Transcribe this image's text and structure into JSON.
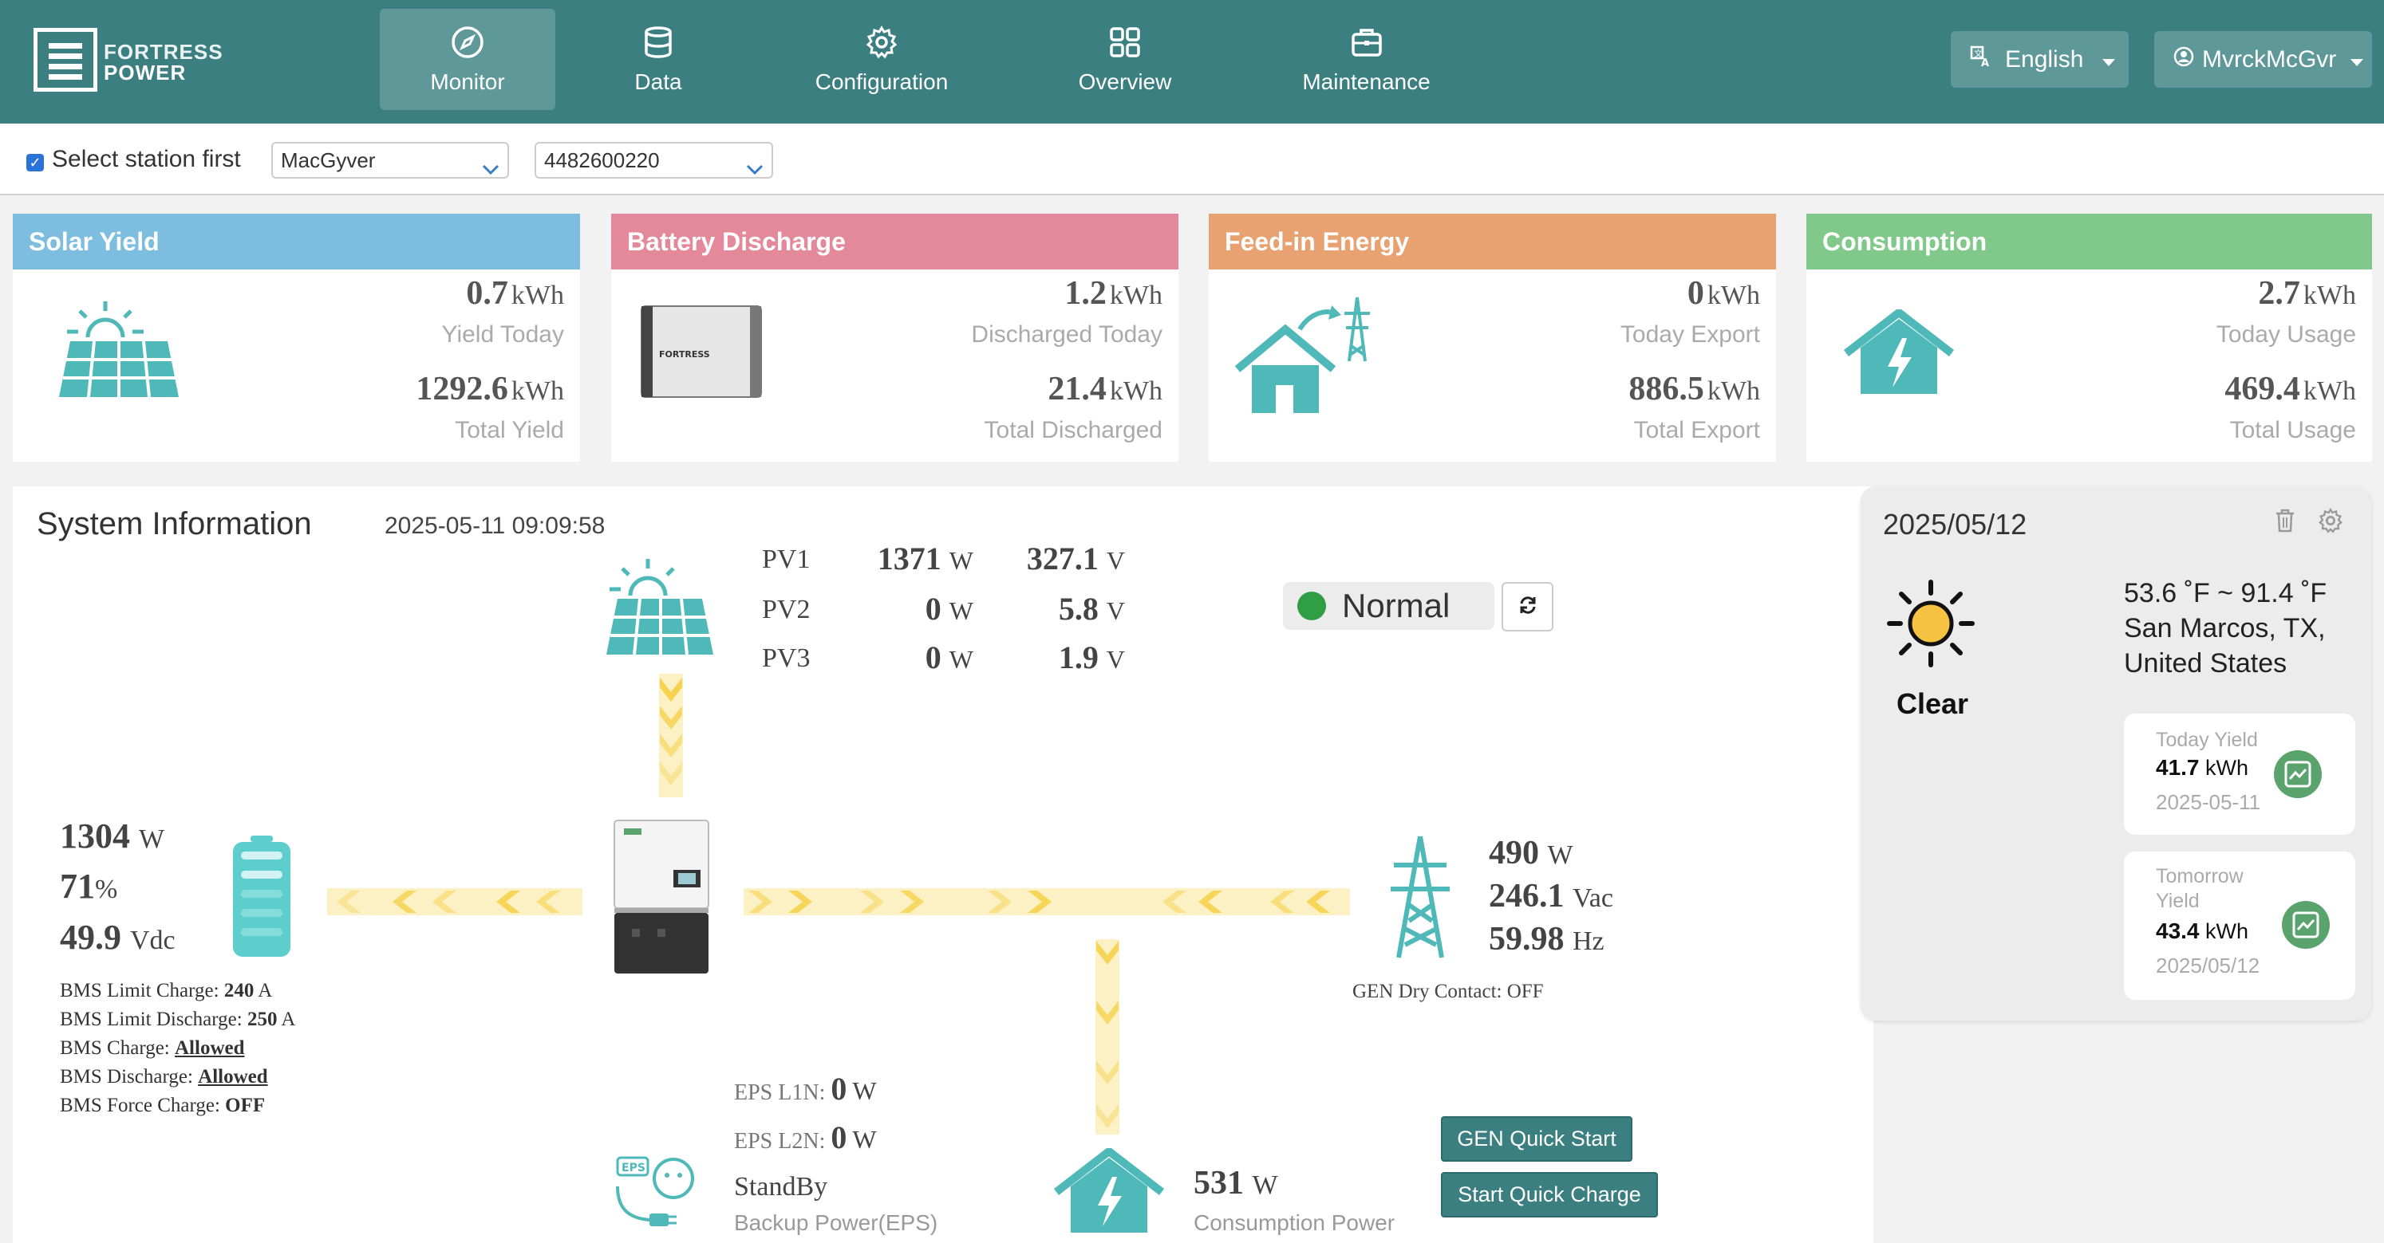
{
  "header": {
    "logo_line1": "FORTRESS",
    "logo_line2": "POWER",
    "nav": [
      {
        "label": "Monitor",
        "icon": "compass-icon",
        "active": true
      },
      {
        "label": "Data",
        "icon": "database-icon"
      },
      {
        "label": "Configuration",
        "icon": "gear-icon"
      },
      {
        "label": "Overview",
        "icon": "grid-icon"
      },
      {
        "label": "Maintenance",
        "icon": "briefcase-icon"
      }
    ],
    "language": "English",
    "user": "MvrckMcGvr"
  },
  "station_bar": {
    "checkbox_label": "Select station first",
    "checked": true,
    "station": "MacGyver",
    "serial": "4482600220"
  },
  "cards": {
    "solar": {
      "title": "Solar Yield",
      "v1": "0.7",
      "u1": "kWh",
      "l1": "Yield Today",
      "v2": "1292.6",
      "u2": "kWh",
      "l2": "Total Yield",
      "color": "#7dbde0"
    },
    "battery": {
      "title": "Battery Discharge",
      "v1": "1.2",
      "u1": "kWh",
      "l1": "Discharged Today",
      "v2": "21.4",
      "u2": "kWh",
      "l2": "Total Discharged",
      "color": "#e4889b",
      "device_text": "FORTRESS"
    },
    "feedin": {
      "title": "Feed-in Energy",
      "v1": "0",
      "u1": "kWh",
      "l1": "Today Export",
      "v2": "886.5",
      "u2": "kWh",
      "l2": "Total Export",
      "color": "#e8a170"
    },
    "consumption": {
      "title": "Consumption",
      "v1": "2.7",
      "u1": "kWh",
      "l1": "Today Usage",
      "v2": "469.4",
      "u2": "kWh",
      "l2": "Total Usage",
      "color": "#80c98a"
    }
  },
  "system": {
    "title": "System Information",
    "timestamp": "2025-05-11 09:09:58",
    "pv": [
      {
        "label": "PV1",
        "w": "1371",
        "v": "327.1"
      },
      {
        "label": "PV2",
        "w": "0",
        "v": "5.8"
      },
      {
        "label": "PV3",
        "w": "0",
        "v": "1.9"
      }
    ],
    "unit_w": "W",
    "unit_v": "V",
    "status": "Normal",
    "battery": {
      "power": "1304",
      "soc": "71",
      "soc_unit": "%",
      "voltage": "49.9",
      "voltage_unit": "Vdc"
    },
    "bms": [
      {
        "k": "BMS Limit Charge:",
        "v": "240",
        "u": "A"
      },
      {
        "k": "BMS Limit Discharge:",
        "v": "250",
        "u": "A"
      },
      {
        "k": "BMS Charge:",
        "v": "Allowed",
        "u": ""
      },
      {
        "k": "BMS Discharge:",
        "v": "Allowed",
        "u": ""
      },
      {
        "k": "BMS Force Charge:",
        "v": "OFF",
        "u": ""
      }
    ],
    "grid": {
      "power": "490",
      "voltage": "246.1",
      "voltage_unit": "Vac",
      "freq": "59.98",
      "freq_unit": "Hz",
      "gen_contact": "GEN Dry Contact: OFF"
    },
    "eps": {
      "l1_label": "EPS L1N:",
      "l1": "0",
      "l2_label": "EPS L2N:",
      "l2": "0",
      "state": "StandBy",
      "caption": "Backup Power(EPS)",
      "icon_text": "EPS"
    },
    "consumption": {
      "power": "531",
      "caption": "Consumption Power"
    },
    "gen_quick_start": "GEN Quick Start",
    "start_quick_charge": "Start Quick Charge"
  },
  "weather": {
    "date": "2025/05/12",
    "condition": "Clear",
    "temp": "53.6 ˚F ~ 91.4 ˚F",
    "location1": "San Marcos, TX,",
    "location2": "United States",
    "today": {
      "title": "Today Yield",
      "value": "41.7",
      "unit": "kWh",
      "date": "2025-05-11"
    },
    "tomorrow": {
      "title1": "Tomorrow",
      "title2": "Yield",
      "value": "43.4",
      "unit": "kWh",
      "date": "2025/05/12"
    }
  }
}
